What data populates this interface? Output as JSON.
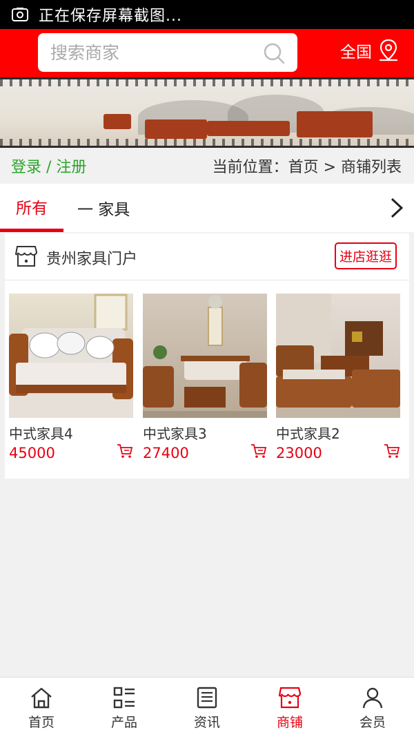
{
  "status": {
    "text": "正在保存屏幕截图..."
  },
  "header": {
    "search_placeholder": "搜索商家",
    "region_label": "全国"
  },
  "crumb": {
    "login": "登录 / 注册",
    "location": "当前位置：首页 > 商铺列表"
  },
  "tabs": {
    "all": "所有",
    "furniture": "一 家具"
  },
  "shop": {
    "name": "贵州家具门户",
    "visit_label": "进店逛逛",
    "products": [
      {
        "name": "中式家具4",
        "price": "45000"
      },
      {
        "name": "中式家具3",
        "price": "27400"
      },
      {
        "name": "中式家具2",
        "price": "23000"
      }
    ]
  },
  "nav": [
    {
      "label": "首页",
      "icon": "home-icon"
    },
    {
      "label": "产品",
      "icon": "grid-list-icon"
    },
    {
      "label": "资讯",
      "icon": "news-icon"
    },
    {
      "label": "商铺",
      "icon": "store-icon"
    },
    {
      "label": "会员",
      "icon": "user-icon"
    }
  ],
  "colors": {
    "brand_red": "#ff0000",
    "accent_red": "#e60012",
    "login_green": "#2aa52a"
  }
}
